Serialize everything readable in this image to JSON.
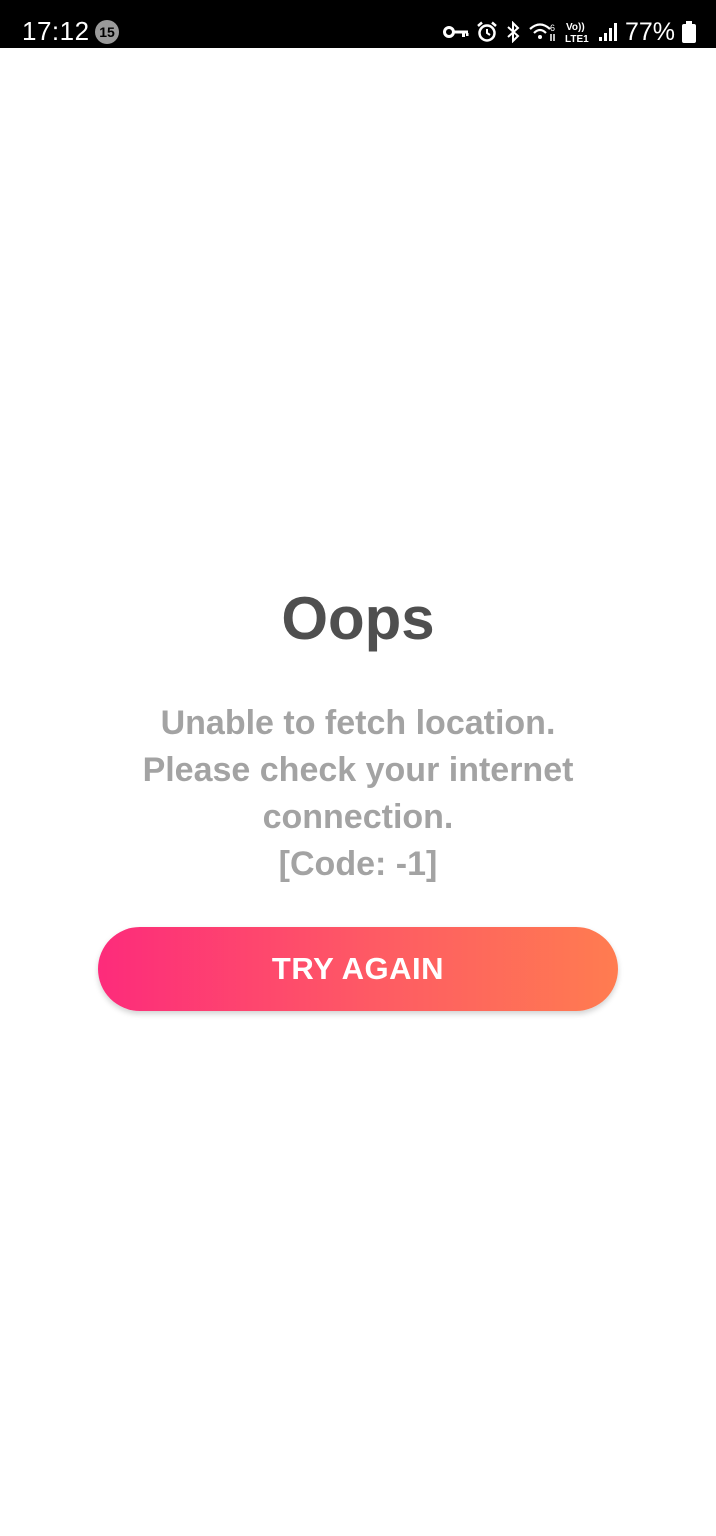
{
  "status_bar": {
    "time": "17:12",
    "notification_count": "15",
    "battery_percent": "77%",
    "network_label_top": "Vo))",
    "network_label_bottom": "LTE1",
    "wifi_label": "6"
  },
  "error": {
    "title": "Oops",
    "message_lines": [
      "Unable to fetch location.",
      "Please check your internet",
      "connection.",
      "[Code: -1]"
    ],
    "button_label": "TRY AGAIN"
  },
  "colors": {
    "button_gradient_start": "#fd2b7b",
    "button_gradient_end": "#ff7c50",
    "title": "#4f4f4f",
    "message": "#a3a3a3"
  }
}
